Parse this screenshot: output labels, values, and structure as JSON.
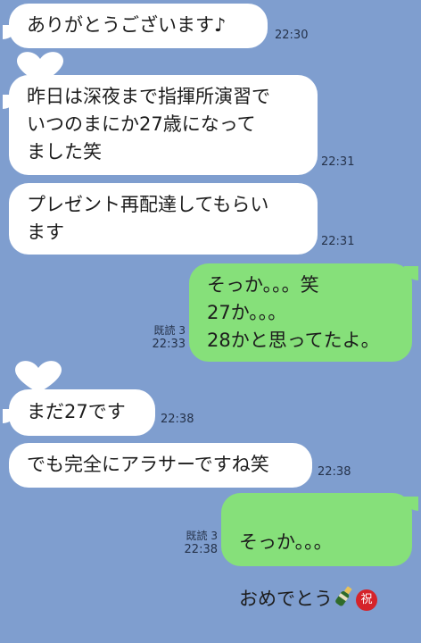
{
  "colors": {
    "background": "#7f9ecf",
    "incoming": "#ffffff",
    "outgoing": "#86e07a",
    "badge": "#d5232a"
  },
  "messages": [
    {
      "text": "ありがとうございます♪",
      "time": "22:30"
    },
    {
      "text": "昨日は深夜まで指揮所演習で\nいつのまにか27歳になって\nました笑",
      "time": "22:31"
    },
    {
      "text": "プレゼント再配達してもらい\nます",
      "time": "22:31"
    },
    {
      "text": "そっか。。。笑\n27か。。。\n28かと思ってたよ。",
      "time": "22:33",
      "read": "既読 3"
    },
    {
      "text": "まだ27です",
      "time": "22:38"
    },
    {
      "text": "でも完全にアラサーですね笑",
      "time": "22:38"
    },
    {
      "line1": "そっか。。。",
      "line2": "おめでとう",
      "emoji_bottle": "champagne-icon",
      "emoji_badge": "祝",
      "time": "22:38",
      "read": "既読 3"
    }
  ]
}
